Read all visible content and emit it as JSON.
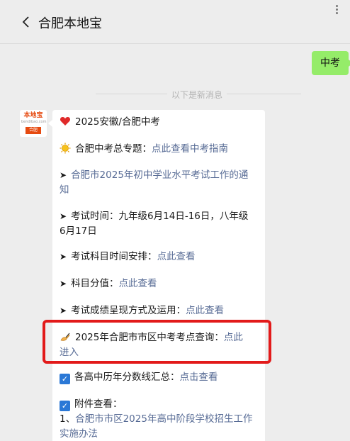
{
  "header": {
    "title": "合肥本地宝"
  },
  "sent_message": "中考",
  "divider": "以下是新消息",
  "avatar": {
    "logo_text": "本地宝",
    "logo_sub": "bendibao.com",
    "city": "合肥"
  },
  "message": {
    "line1": "2025安徽/合肥中考",
    "line2_prefix": "合肥中考总专题：",
    "line2_link": "点此查看中考指南",
    "line3_link_a": "合肥市2025年初中学业水平考试工作的通",
    "line3_link_b": "知",
    "line4_a": "考试时间：九年级6月14日-16日，八年级",
    "line4_b": "6月17日",
    "line5_prefix": "考试科目时间安排：",
    "line5_link": "点此查看",
    "line6_prefix": "科目分值：",
    "line6_link": "点此查看",
    "line7_prefix": "考试成绩呈现方式及运用：",
    "line7_link": "点此查看",
    "line8_prefix": "2025年合肥市市区中考考点查询：",
    "line8_link_a": "点此",
    "line8_link_b": "进入",
    "line9_prefix": "各高中历年分数线汇总：",
    "line9_link": "点击查看",
    "line10": "附件查看：",
    "line11_prefix": "1、",
    "line11_link_a": "合肥市市区2025年高中阶段学校招生工作",
    "line11_link_b": "实施办法"
  },
  "icons": {
    "back": "chevron-left-icon",
    "more": "more-vertical-icon"
  },
  "colors": {
    "link": "#576b95",
    "sent_bubble": "#95ec69",
    "highlight": "#e21a1a"
  }
}
